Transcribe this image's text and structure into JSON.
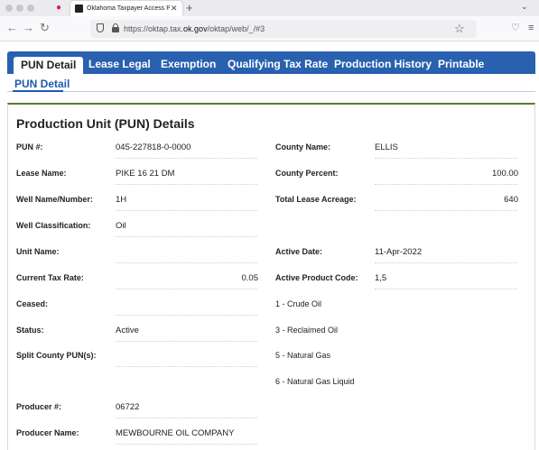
{
  "browser": {
    "tab_title": "Oklahoma Taxpayer Access Point",
    "url_prefix": "https://oktap.tax.",
    "url_domain": "ok.gov",
    "url_suffix": "/oktap/web/_/#3"
  },
  "tabs": [
    {
      "label": "PUN Detail",
      "active": true
    },
    {
      "label": "Lease Legal"
    },
    {
      "label": "Exemption"
    },
    {
      "label": "Qualifying Tax Rate"
    },
    {
      "label": "Production History"
    },
    {
      "label": "Printable"
    }
  ],
  "subtab": "PUN Detail",
  "card_title": "Production Unit (PUN) Details",
  "left_fields": [
    {
      "label": "PUN #:",
      "value": "045-227818-0-0000"
    },
    {
      "label": "Lease Name:",
      "value": "PIKE 16 21 DM"
    },
    {
      "label": "Well Name/Number:",
      "value": "1H"
    },
    {
      "label": "Well Classification:",
      "value": "Oil"
    },
    {
      "label": "Unit Name:",
      "value": ""
    },
    {
      "label": "Current Tax Rate:",
      "value": "0.05"
    },
    {
      "label": "Ceased:",
      "value": ""
    },
    {
      "label": "Status:",
      "value": "Active"
    },
    {
      "label": "Split County PUN(s):",
      "value": ""
    },
    {
      "label": "Producer #:",
      "value": "06722"
    },
    {
      "label": "Producer Name:",
      "value": "MEWBOURNE OIL COMPANY"
    }
  ],
  "right_fields": [
    {
      "label": "County Name:",
      "value": "ELLIS"
    },
    {
      "label": "County Percent:",
      "value": "100.00"
    },
    {
      "label": "Total Lease Acreage:",
      "value": "640"
    },
    {
      "label": "Active Date:",
      "value": "11-Apr-2022"
    },
    {
      "label": "Active Product Code:",
      "value": "1,5"
    }
  ],
  "product_codes": [
    "1 - Crude Oil",
    "3 - Reclaimed Oil",
    "5 - Natural Gas",
    "6 - Natural Gas Liquid"
  ]
}
